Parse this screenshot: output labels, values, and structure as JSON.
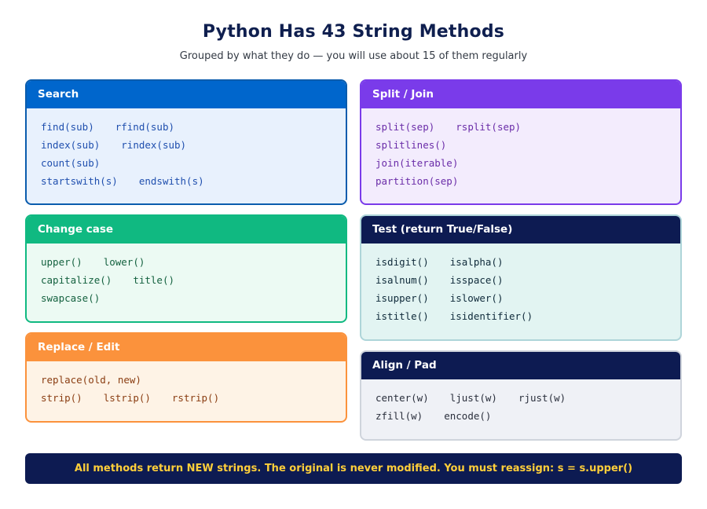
{
  "title": "Python Has 43 String Methods",
  "subtitle": "Grouped by what they do — you will use about 15 of them regularly",
  "groups": {
    "search": {
      "label": "Search",
      "rows": [
        [
          "find(sub)",
          "rfind(sub)"
        ],
        [
          "index(sub)",
          "rindex(sub)"
        ],
        [
          "count(sub)"
        ],
        [
          "startswith(s)",
          "endswith(s)"
        ]
      ],
      "colors": {
        "header": "#0066cc",
        "border": "#0a5cad",
        "body": "#e8f1fd",
        "text": "#1f4fae"
      }
    },
    "split": {
      "label": "Split / Join",
      "rows": [
        [
          "split(sep)",
          "rsplit(sep)"
        ],
        [
          "splitlines()"
        ],
        [
          "join(iterable)"
        ],
        [
          "partition(sep)"
        ]
      ],
      "colors": {
        "header": "#7a3bea",
        "border": "#7a3bea",
        "body": "#f3ecfd",
        "text": "#6a2ca8"
      }
    },
    "case": {
      "label": "Change case",
      "rows": [
        [
          "upper()",
          "lower()"
        ],
        [
          "capitalize()",
          "title()"
        ],
        [
          "swapcase()"
        ]
      ],
      "colors": {
        "header": "#10b981",
        "border": "#10b981",
        "body": "#ecfaf3",
        "text": "#14613f"
      }
    },
    "test": {
      "label": "Test (return True/False)",
      "rows": [
        [
          "isdigit()",
          "isalpha()"
        ],
        [
          "isalnum()",
          "isspace()"
        ],
        [
          "isupper()",
          "islower()"
        ],
        [
          "istitle()",
          "isidentifier()"
        ]
      ],
      "colors": {
        "header": "#0d1b52",
        "border": "#aed5d9",
        "body": "#e2f4f2",
        "text": "#0f2a3a"
      }
    },
    "replace": {
      "label": "Replace / Edit",
      "rows": [
        [
          "replace(old, new)"
        ],
        [
          "strip()",
          "lstrip()",
          "rstrip()"
        ]
      ],
      "colors": {
        "header": "#fb923c",
        "border": "#fb923c",
        "body": "#fef3e6",
        "text": "#8a3d12"
      }
    },
    "align": {
      "label": "Align / Pad",
      "rows": [
        [
          "center(w)",
          "ljust(w)",
          "rjust(w)"
        ],
        [
          "zfill(w)",
          "encode()"
        ]
      ],
      "colors": {
        "header": "#0d1b52",
        "border": "#cfd4dc",
        "body": "#eff1f6",
        "text": "#2a2f3c"
      }
    }
  },
  "footer": "All methods return NEW strings. The original is never modified. You must reassign: s = s.upper()"
}
